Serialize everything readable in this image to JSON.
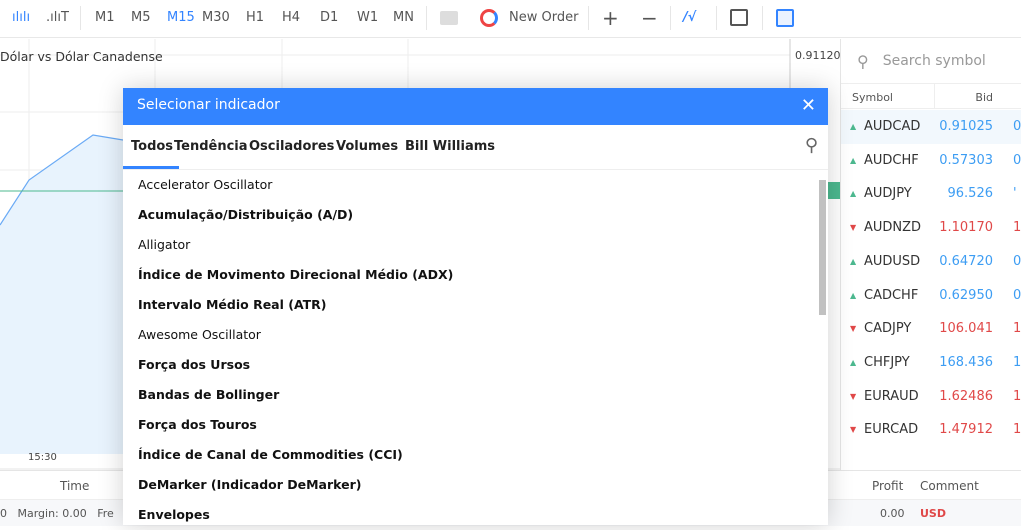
{
  "toolbar": {
    "timeframes": [
      "M1",
      "M5",
      "M15",
      "M30",
      "H1",
      "H4",
      "D1",
      "W1",
      "MN"
    ],
    "active_timeframe": "M15",
    "new_order": "New Order",
    "accent": "#3384ff"
  },
  "chart": {
    "title": "Dólar vs Dólar Canadense",
    "price_label": "0.91120",
    "time_label": "15:30"
  },
  "watchlist": {
    "search_placeholder": "Search symbol",
    "col_symbol": "Symbol",
    "col_bid": "Bid",
    "rows": [
      {
        "symbol": "AUDCAD",
        "bid": "0.91025",
        "ask": "0",
        "dir": "up"
      },
      {
        "symbol": "AUDCHF",
        "bid": "0.57303",
        "ask": "0",
        "dir": "up"
      },
      {
        "symbol": "AUDJPY",
        "bid": "96.526",
        "ask": "'",
        "dir": "up"
      },
      {
        "symbol": "AUDNZD",
        "bid": "1.10170",
        "ask": "1",
        "dir": "down"
      },
      {
        "symbol": "AUDUSD",
        "bid": "0.64720",
        "ask": "0",
        "dir": "up"
      },
      {
        "symbol": "CADCHF",
        "bid": "0.62950",
        "ask": "0",
        "dir": "up"
      },
      {
        "symbol": "CADJPY",
        "bid": "106.041",
        "ask": "1",
        "dir": "down"
      },
      {
        "symbol": "CHFJPY",
        "bid": "168.436",
        "ask": "1",
        "dir": "up"
      },
      {
        "symbol": "EURAUD",
        "bid": "1.62486",
        "ask": "1",
        "dir": "down"
      },
      {
        "symbol": "EURCAD",
        "bid": "1.47912",
        "ask": "1",
        "dir": "down"
      }
    ]
  },
  "bottom": {
    "time": "Time",
    "profit": "Profit",
    "comment": "Comment",
    "margin": "0   Margin: 0.00   Fre",
    "profit_value": "0.00",
    "currency": "USD"
  },
  "dialog": {
    "title": "Selecionar indicador",
    "tabs": [
      "Todos",
      "Tendência",
      "Osciladores",
      "Volumes",
      "Bill Williams"
    ],
    "active_tab": "Todos",
    "items": [
      "Accelerator Oscillator",
      "Acumulação/Distribuição (A/D)",
      "Alligator",
      "Índice de Movimento Direcional Médio (ADX)",
      "Intervalo Médio Real (ATR)",
      "Awesome Oscillator",
      "Força dos Ursos",
      "Bandas de Bollinger",
      "Força dos Touros",
      "Índice de Canal de Commodities (CCI)",
      "DeMarker (Indicador DeMarker)",
      "Envelopes"
    ]
  }
}
